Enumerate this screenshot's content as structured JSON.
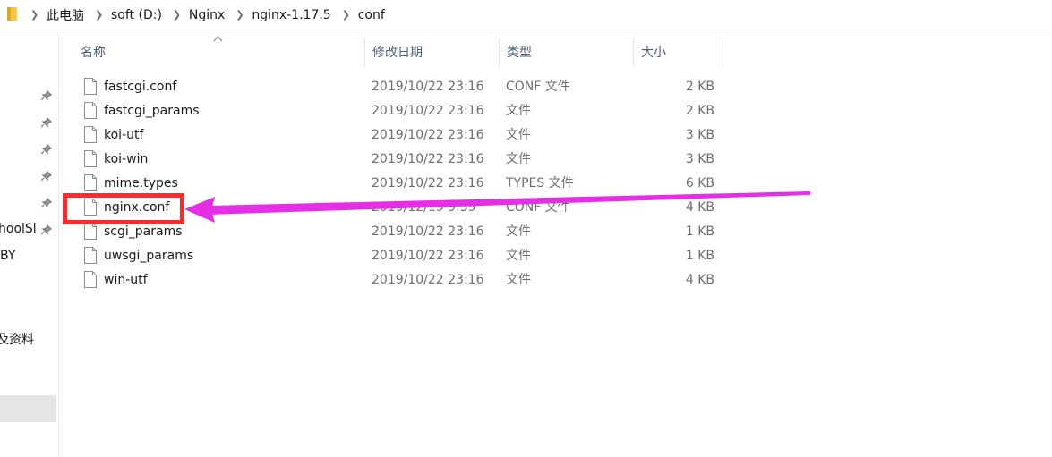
{
  "address_bar": {
    "crumbs": [
      "此电脑",
      "soft (D:)",
      "Nginx",
      "nginx-1.17.5",
      "conf"
    ]
  },
  "nav_pane": {
    "partial_labels": [
      "hoolSl",
      "BY",
      "及资料"
    ]
  },
  "columns": {
    "name": "名称",
    "date": "修改日期",
    "type": "类型",
    "size": "大小"
  },
  "files": [
    {
      "name": "fastcgi.conf",
      "date": "2019/10/22 23:16",
      "type": "CONF 文件",
      "size": "2 KB"
    },
    {
      "name": "fastcgi_params",
      "date": "2019/10/22 23:16",
      "type": "文件",
      "size": "2 KB"
    },
    {
      "name": "koi-utf",
      "date": "2019/10/22 23:16",
      "type": "文件",
      "size": "3 KB"
    },
    {
      "name": "koi-win",
      "date": "2019/10/22 23:16",
      "type": "文件",
      "size": "3 KB"
    },
    {
      "name": "mime.types",
      "date": "2019/10/22 23:16",
      "type": "TYPES 文件",
      "size": "6 KB"
    },
    {
      "name": "nginx.conf",
      "date": "2019/12/19 9:59",
      "type": "CONF 文件",
      "size": "4 KB"
    },
    {
      "name": "scgi_params",
      "date": "2019/10/22 23:16",
      "type": "文件",
      "size": "1 KB"
    },
    {
      "name": "uwsgi_params",
      "date": "2019/10/22 23:16",
      "type": "文件",
      "size": "1 KB"
    },
    {
      "name": "win-utf",
      "date": "2019/10/22 23:16",
      "type": "文件",
      "size": "4 KB"
    }
  ],
  "colors": {
    "highlight_box": "#ff2a2a",
    "arrow": "#e62ee6",
    "header_text": "#4c607a"
  }
}
